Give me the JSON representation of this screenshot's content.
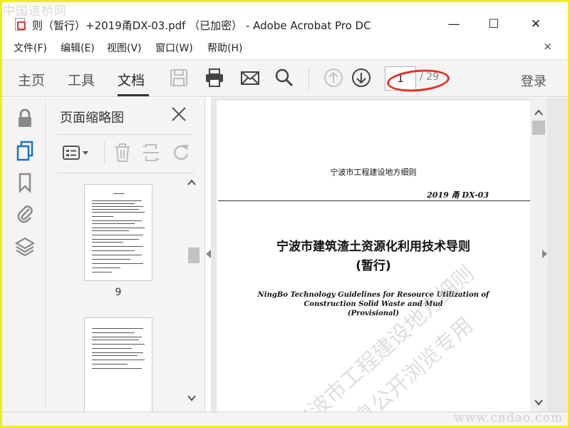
{
  "watermarks": {
    "site_top": "中国道桥网",
    "site_bottom": "www.cndao.com"
  },
  "window": {
    "title": "则（暂行）+2019甬DX-03.pdf （已加密） - Adobe Acrobat Pro DC",
    "minimize": "—",
    "maximize": "☐",
    "close": "✕"
  },
  "menu": {
    "items": [
      "文件(F)",
      "编辑(E)",
      "视图(V)",
      "窗口(W)",
      "帮助(H)"
    ],
    "close": "×"
  },
  "toolbar": {
    "tabs": [
      "主页",
      "工具",
      "文档"
    ],
    "active_tab": "文档",
    "page_current": "1",
    "page_total": "/ 29",
    "signin": "登录",
    "icons": [
      "save-icon",
      "print-icon",
      "email-icon",
      "search-icon",
      "prev-page-icon",
      "next-page-icon"
    ]
  },
  "left_rail": {
    "icons": [
      "lock-icon",
      "page-thumbnails-icon",
      "bookmark-icon",
      "attachment-icon",
      "layers-icon"
    ]
  },
  "thumbnails": {
    "title": "页面缩略图",
    "tools": [
      "options-icon",
      "delete-icon",
      "crop-icon",
      "rotate-icon"
    ],
    "pages": [
      {
        "label": "9"
      },
      {
        "label": ""
      }
    ]
  },
  "document": {
    "header": "宁波市工程建设地方细则",
    "code": "2019 甬  DX-03",
    "title": "宁波市建筑渣土资源化利用技术导则",
    "subtitle": "(暂行)",
    "english_lines": [
      "NingBo Technology Guidelines for Resource Utilization of",
      "Construction Solid Waste and Mud",
      "(Provisional)"
    ],
    "watermark_lines": [
      "宁波市工程建设地方细则",
      "信息公开浏览专用"
    ]
  },
  "colors": {
    "accent_frame": "#f2ea1b",
    "annotation_red": "#e53022",
    "toolbar_bg": "#f4f4f4"
  }
}
